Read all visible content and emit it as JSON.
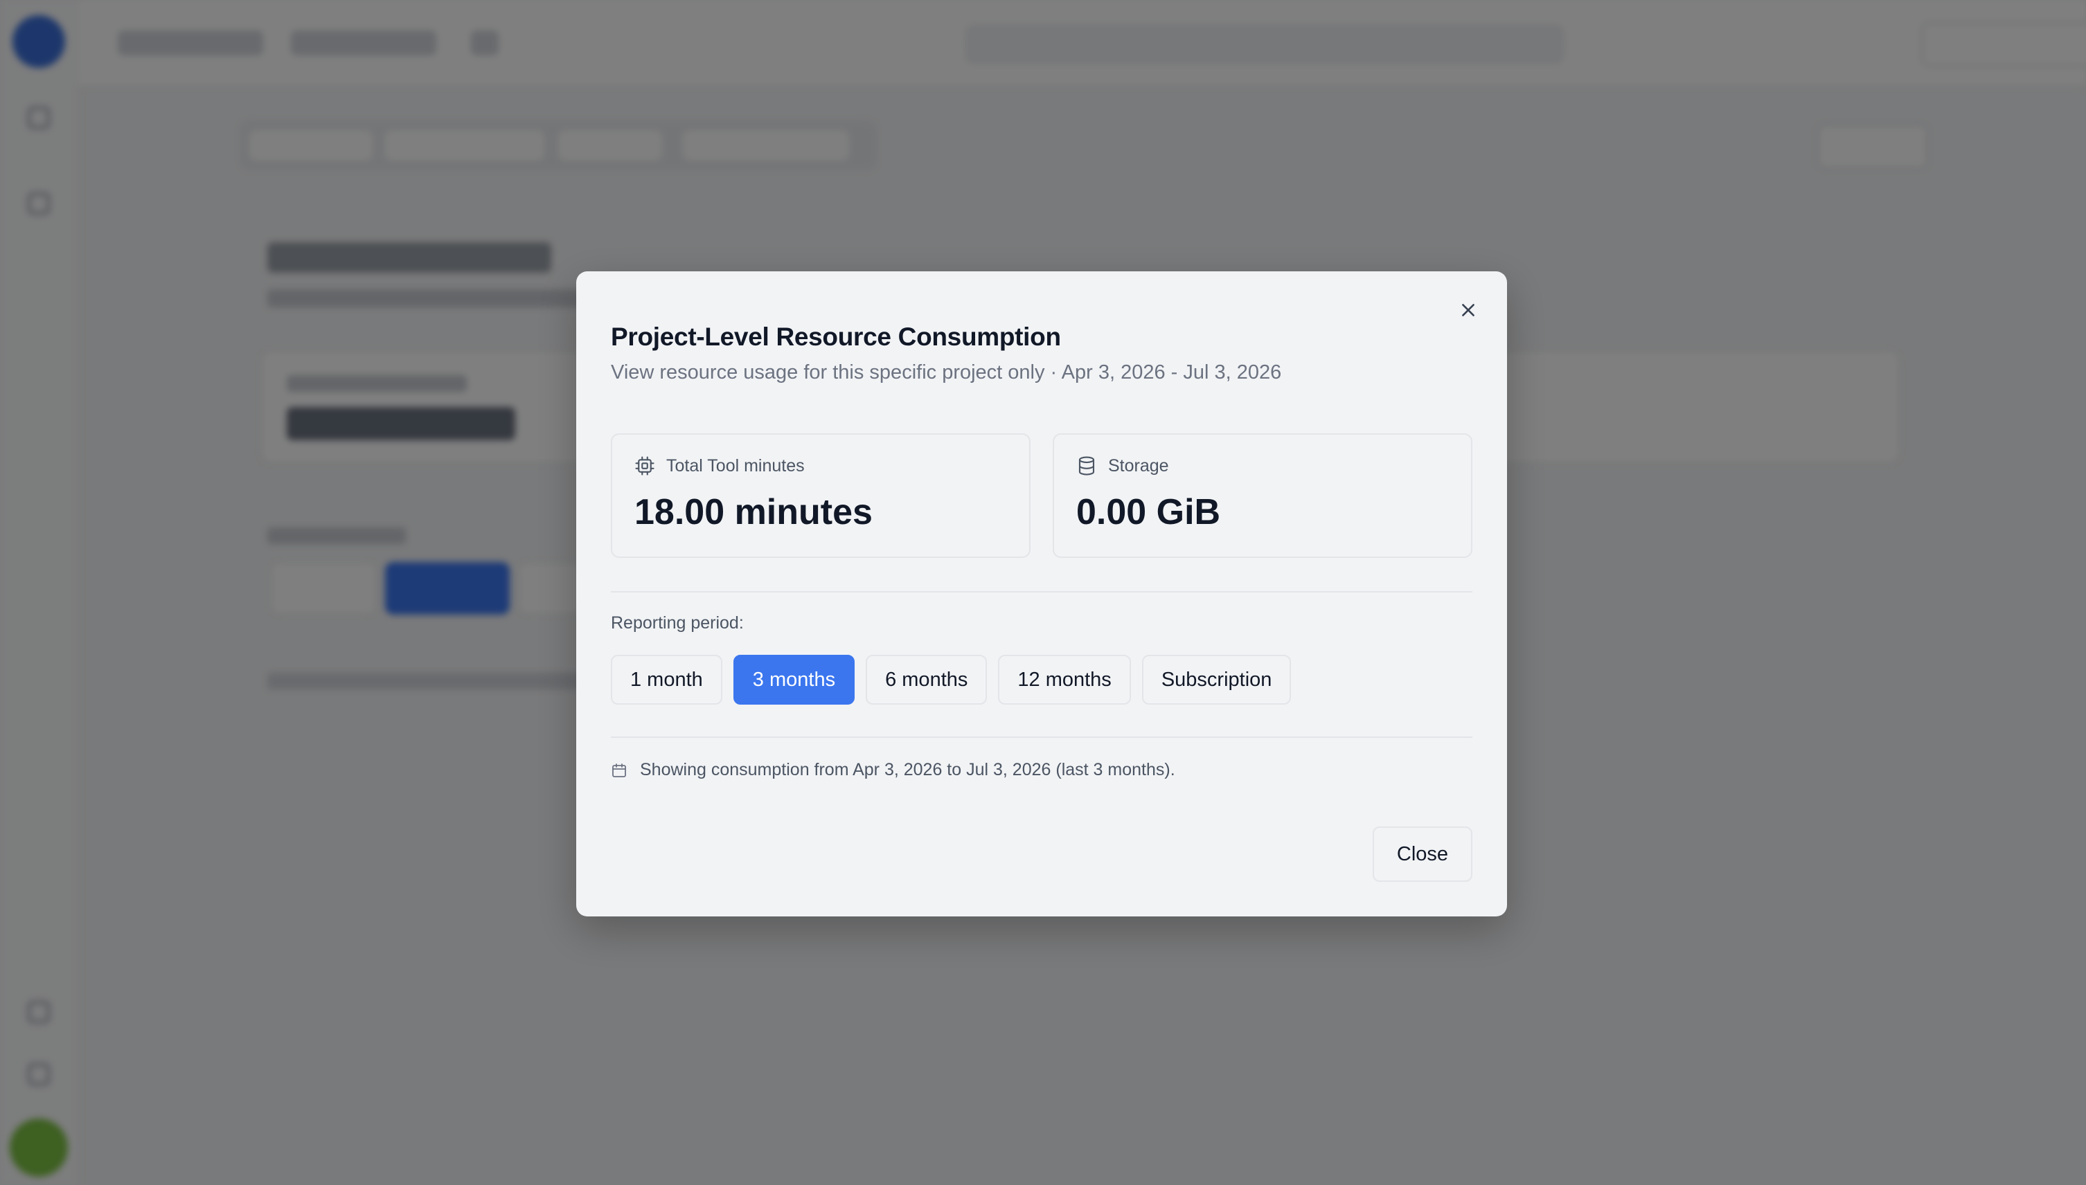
{
  "modal": {
    "title": "Project-Level Resource Consumption",
    "subtitle": "View resource usage for this specific project only · Apr 3, 2026 - Jul 3, 2026",
    "cards": [
      {
        "label": "Total Tool minutes",
        "value": "18.00 minutes",
        "icon": "cpu-icon"
      },
      {
        "label": "Storage",
        "value": "0.00 GiB",
        "icon": "database-icon"
      }
    ],
    "period_label": "Reporting period:",
    "periods": [
      "1 month",
      "3 months",
      "6 months",
      "12 months",
      "Subscription"
    ],
    "selected_period": "3 months",
    "info_text": "Showing consumption from Apr 3, 2026 to Jul 3, 2026 (last 3 months).",
    "info_icon": "calendar-icon",
    "close_label": "Close",
    "close_icon": "close-icon"
  },
  "colors": {
    "accent": "#3b76ee",
    "overlay": "rgba(0,0,0,0.5)",
    "modal_bg": "#f2f3f5"
  }
}
